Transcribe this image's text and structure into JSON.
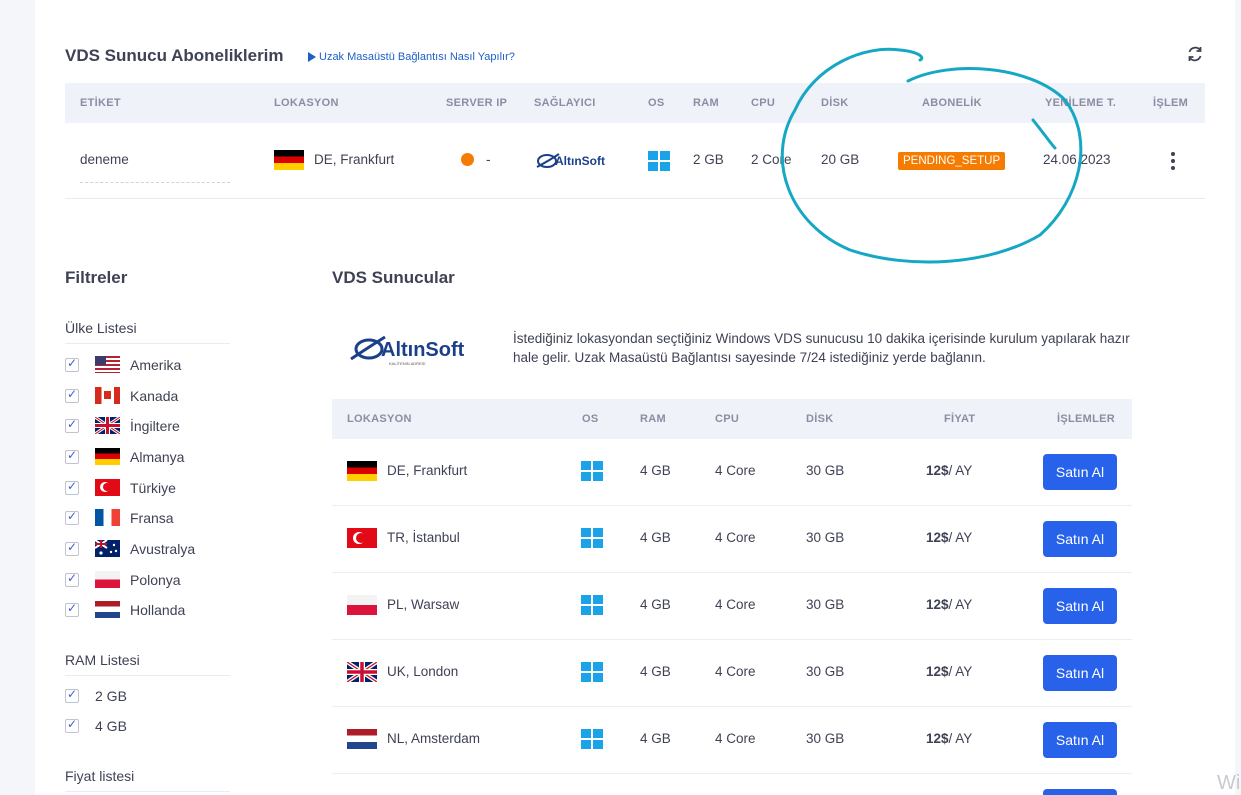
{
  "subscriptions": {
    "title": "VDS Sunucu Aboneliklerim",
    "help_link": "Uzak Masaüstü Bağlantısı Nasıl Yapılır?",
    "columns": [
      "ETİKET",
      "LOKASYON",
      "SERVER IP",
      "SAĞLAYICI",
      "OS",
      "RAM",
      "CPU",
      "DİSK",
      "ABONELİK",
      "YENİLEME T.",
      "İŞLEM"
    ],
    "row": {
      "label": "deneme",
      "location": "DE, Frankfurt",
      "server_ip": "-",
      "provider": "AltınSoft",
      "os": "windows-icon",
      "ram": "2 GB",
      "cpu": "2 Core",
      "disk": "20 GB",
      "status": "PENDING_SETUP",
      "renewal": "24.06.2023"
    }
  },
  "filters": {
    "title": "Filtreler",
    "country_list_title": "Ülke Listesi",
    "countries": [
      "Amerika",
      "Kanada",
      "İngiltere",
      "Almanya",
      "Türkiye",
      "Fransa",
      "Avustralya",
      "Polonya",
      "Hollanda"
    ],
    "ram_list_title": "RAM Listesi",
    "ram_options": [
      "2 GB",
      "4 GB"
    ],
    "price_list_title": "Fiyat listesi"
  },
  "servers": {
    "title": "VDS Sunucular",
    "brand": "AltınSoft",
    "brand_tagline": "KALİTENİN ADRESİ",
    "description": "İstediğiniz lokasyondan seçtiğiniz Windows VDS sunucusu 10 dakika içerisinde kurulum yapılarak hazır hale gelir. Uzak Masaüstü Bağlantısı sayesinde 7/24 istediğiniz yerde bağlanın.",
    "columns": [
      "LOKASYON",
      "OS",
      "RAM",
      "CPU",
      "DİSK",
      "FİYAT",
      "İŞLEMLER"
    ],
    "rows": [
      {
        "location": "DE, Frankfurt",
        "ram": "4 GB",
        "cpu": "4 Core",
        "disk": "30 GB",
        "price": "12$",
        "period": "/ AY",
        "action": "Satın Al"
      },
      {
        "location": "TR, İstanbul",
        "ram": "4 GB",
        "cpu": "4 Core",
        "disk": "30 GB",
        "price": "12$",
        "period": "/ AY",
        "action": "Satın Al"
      },
      {
        "location": "PL, Warsaw",
        "ram": "4 GB",
        "cpu": "4 Core",
        "disk": "30 GB",
        "price": "12$",
        "period": "/ AY",
        "action": "Satın Al"
      },
      {
        "location": "UK, London",
        "ram": "4 GB",
        "cpu": "4 Core",
        "disk": "30 GB",
        "price": "12$",
        "period": "/ AY",
        "action": "Satın Al"
      },
      {
        "location": "NL, Amsterdam",
        "ram": "4 GB",
        "cpu": "4 Core",
        "disk": "30 GB",
        "price": "12$",
        "period": "/ AY",
        "action": "Satın Al"
      }
    ]
  },
  "watermark": "Wi",
  "colors": {
    "accent": "#2962ea",
    "status": "#f57c00",
    "annotation": "#16a7c4",
    "windows": "#1aa3e8"
  }
}
